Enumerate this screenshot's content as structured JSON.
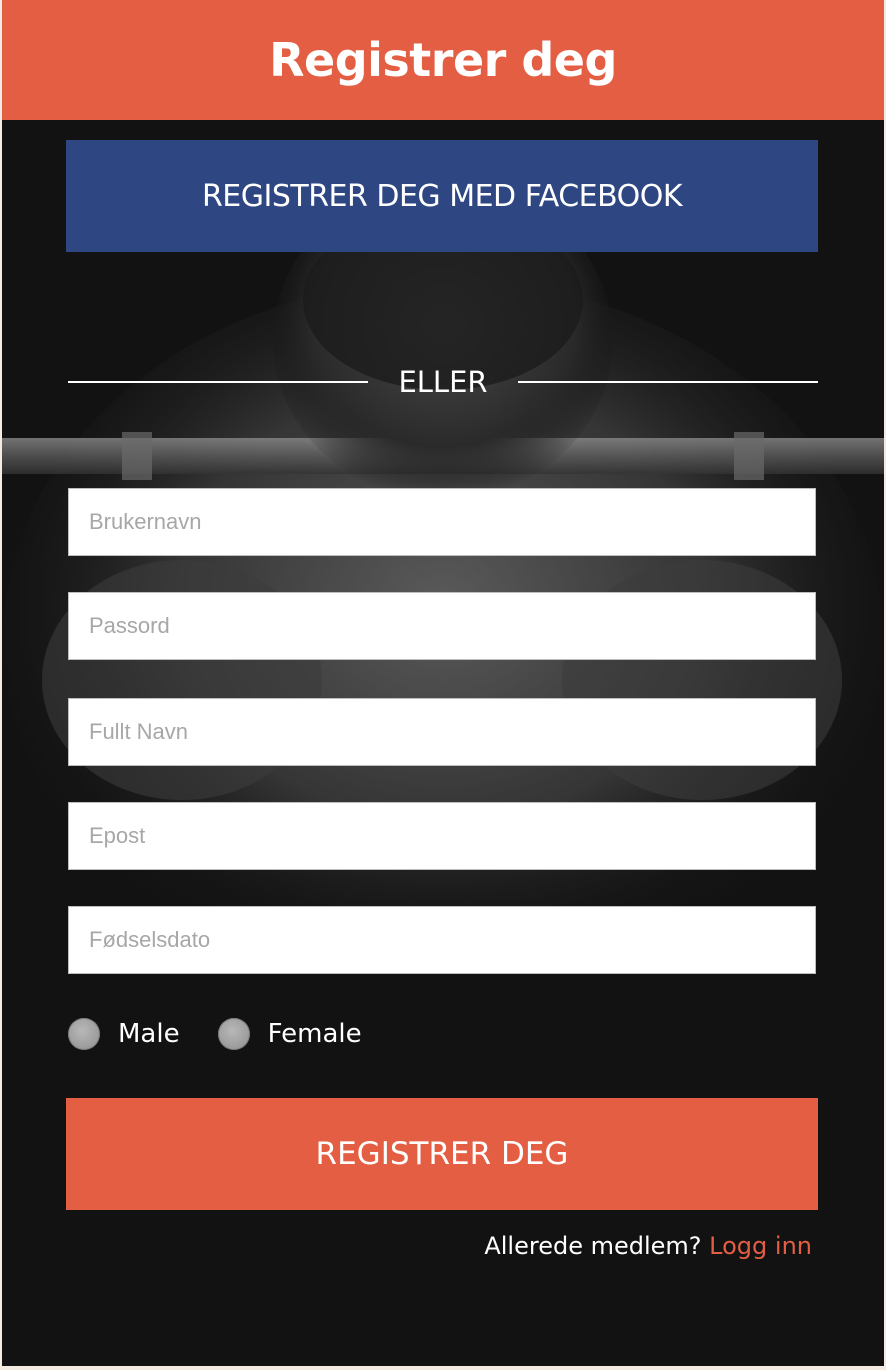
{
  "header": {
    "title": "Registrer deg"
  },
  "facebook_button": {
    "label": "REGISTRER DEG MED FACEBOOK"
  },
  "divider": {
    "label": "ELLER"
  },
  "form": {
    "username": {
      "placeholder": "Brukernavn",
      "value": ""
    },
    "password": {
      "placeholder": "Passord",
      "value": ""
    },
    "full_name": {
      "placeholder": "Fullt Navn",
      "value": ""
    },
    "email": {
      "placeholder": "Epost",
      "value": ""
    },
    "birthdate": {
      "placeholder": "Fødselsdato",
      "value": ""
    },
    "gender_options": [
      {
        "label": "Male",
        "selected": false
      },
      {
        "label": "Female",
        "selected": false
      }
    ]
  },
  "submit_button": {
    "label": "REGISTRER DEG"
  },
  "login_prompt": {
    "text": "Allerede medlem?",
    "link_label": "Logg inn"
  },
  "colors": {
    "accent": "#e35e43",
    "facebook": "#2e4783",
    "background": "#121212",
    "outer": "#f4ece2"
  },
  "icons": {
    "background_image": "weightlifter-photo"
  }
}
